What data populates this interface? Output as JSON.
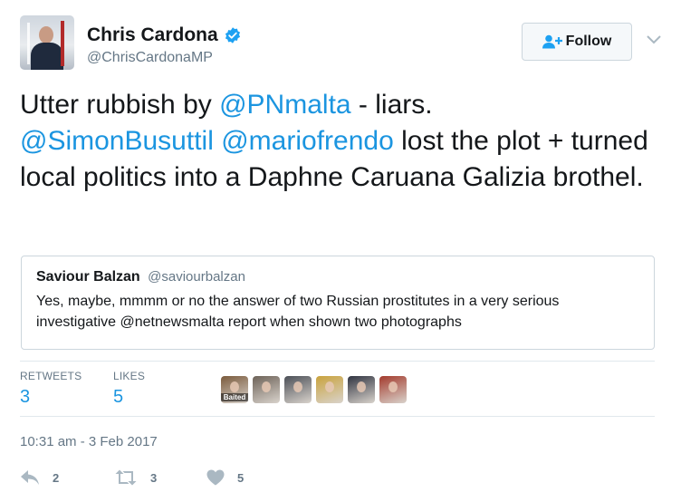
{
  "author": {
    "display_name": "Chris Cardona",
    "screen_name": "@ChrisCardonaMP"
  },
  "follow_button": {
    "label": "Follow"
  },
  "tweet": {
    "segments": [
      {
        "text": "Utter rubbish by ",
        "type": "text"
      },
      {
        "text": "@PNmalta",
        "type": "mention"
      },
      {
        "text": " - liars.",
        "type": "text"
      },
      {
        "text": "\n",
        "type": "break"
      },
      {
        "text": "@SimonBusuttil",
        "type": "mention"
      },
      {
        "text": " ",
        "type": "text"
      },
      {
        "text": "@mariofrendo",
        "type": "mention"
      },
      {
        "text": " lost the plot + turned local politics into a Daphne Caruana Galizia brothel.",
        "type": "text"
      }
    ]
  },
  "quoted_tweet": {
    "display_name": "Saviour Balzan",
    "screen_name": "@saviourbalzan",
    "text_before": "Yes, maybe, mmmm or no the answer of two Russian prostitutes in a very serious investigative ",
    "mention": "@netnewsmalta",
    "text_after": " report when shown two photographs"
  },
  "stats": {
    "retweets_label": "RETWEETS",
    "retweets_count": "3",
    "likes_label": "LIKES",
    "likes_count": "5"
  },
  "likers": [
    {
      "name": "liker-1",
      "label": "Baited",
      "color": "#7a5a3c"
    },
    {
      "name": "liker-2",
      "label": "",
      "color": "#6d6258"
    },
    {
      "name": "liker-3",
      "label": "",
      "color": "#4b4f57"
    },
    {
      "name": "liker-4",
      "label": "",
      "color": "#c9a23c"
    },
    {
      "name": "liker-5",
      "label": "",
      "color": "#2f3340"
    },
    {
      "name": "liker-6",
      "label": "",
      "color": "#a33a2c"
    }
  ],
  "timestamp": "10:31 am - 3 Feb 2017",
  "actions": {
    "reply_count": "2",
    "retweet_count": "3",
    "like_count": "5"
  },
  "colors": {
    "link": "#1b95e0",
    "secondary": "#657786",
    "border": "#e1e8ed",
    "verified": "#1da1f2",
    "action_icon": "#aab8c2"
  },
  "icons": [
    "verified-icon",
    "follow-person-icon",
    "chevron-down-icon",
    "reply-icon",
    "retweet-icon",
    "heart-icon"
  ]
}
